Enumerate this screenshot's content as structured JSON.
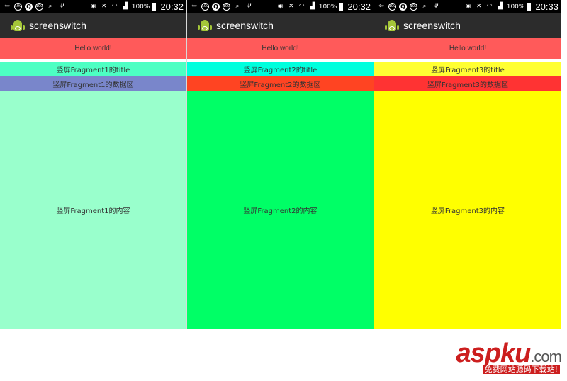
{
  "app": {
    "title": "screenswitch",
    "hello_text": "Hello world!"
  },
  "status_bar": {
    "battery_percent": "100%"
  },
  "phones": [
    {
      "time": "20:32",
      "title_text": "竖屏Fragment1的title",
      "data_text": "竖屏Fragment1的数据区",
      "content_text": "竖屏Fragment1的内容",
      "colors": {
        "title": "#4dffc3",
        "data": "#7986cb",
        "content": "#99ffcc"
      }
    },
    {
      "time": "20:32",
      "title_text": "竖屏Fragment2的title",
      "data_text": "竖屏Fragment2的数据区",
      "content_text": "竖屏Fragment2的内容",
      "colors": {
        "title": "#00ffdd",
        "data": "#ff4422",
        "content": "#00ff66"
      }
    },
    {
      "time": "20:33",
      "title_text": "竖屏Fragment3的title",
      "data_text": "竖屏Fragment3的数据区",
      "content_text": "竖屏Fragment3的内容",
      "colors": {
        "title": "#ffff33",
        "data": "#ff3333",
        "content": "#ffff00"
      }
    }
  ],
  "watermark": {
    "main": "aspku",
    "suffix": ".com",
    "sub": "免费网站源码下载站!"
  },
  "icons": [
    "back-icon",
    "notification-icon",
    "q-app-icon",
    "search-icon",
    "usb-icon",
    "eye-icon",
    "mute-icon",
    "wifi-icon",
    "signal-icon",
    "battery-icon",
    "android-icon"
  ]
}
